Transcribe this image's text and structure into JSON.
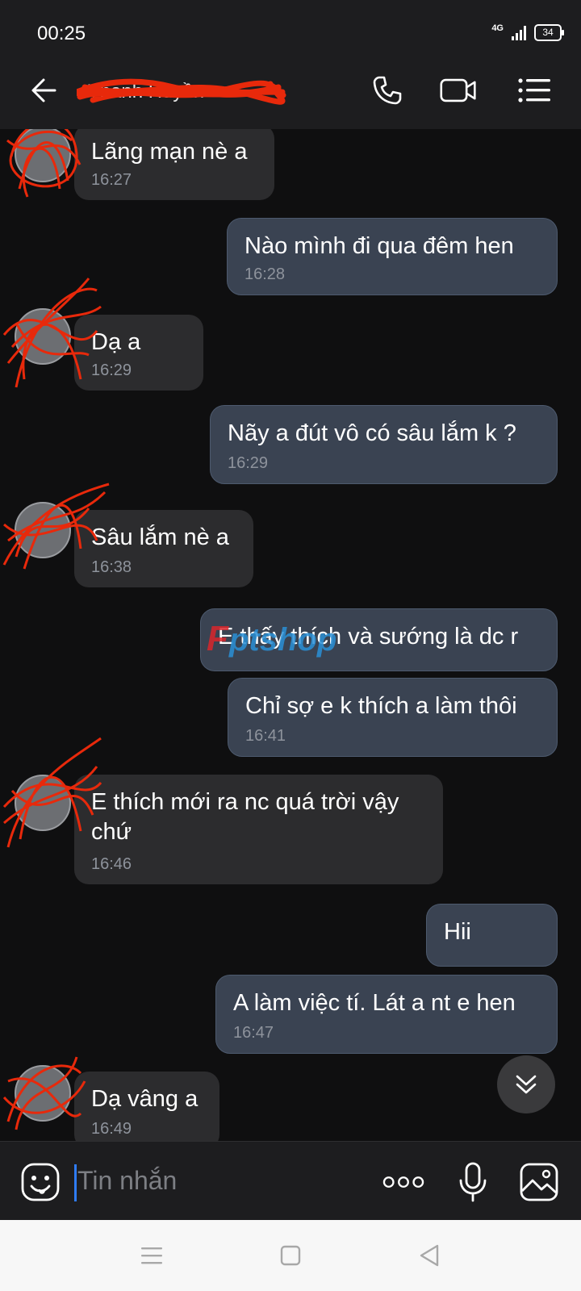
{
  "status": {
    "time": "00:25",
    "network": "4G",
    "battery": "34"
  },
  "header": {
    "contact_name": "Thanh Huyền"
  },
  "messages": [
    {
      "dir": "in",
      "text": "Lãng mạn nè a",
      "time": "16:27"
    },
    {
      "dir": "out",
      "text": "Nào mình đi qua đêm hen",
      "time": "16:28"
    },
    {
      "dir": "in",
      "text": "Dạ a",
      "time": "16:29"
    },
    {
      "dir": "out",
      "text": "Nãy a đút vô có sâu lắm k ?",
      "time": "16:29"
    },
    {
      "dir": "in",
      "text": "Sâu lắm nè a",
      "time": "16:38"
    },
    {
      "dir": "out",
      "text": "E thấy thích và sướng là dc r",
      "time": ""
    },
    {
      "dir": "out",
      "text": "Chỉ sợ e k thích a làm thôi",
      "time": "16:41"
    },
    {
      "dir": "in",
      "text": "E thích mới ra nc quá trời vậy\nchứ",
      "time": "16:46"
    },
    {
      "dir": "out",
      "text": "Hii",
      "time": ""
    },
    {
      "dir": "out",
      "text": "A làm việc tí. Lát a nt e hen",
      "time": "16:47"
    },
    {
      "dir": "in",
      "text": "Dạ vâng a",
      "time": "16:49"
    }
  ],
  "input": {
    "placeholder": "Tin nhắn"
  },
  "watermark": {
    "text": "Fptshop"
  },
  "colors": {
    "incoming_bubble": "#2c2c2e",
    "outgoing_bubble": "#3a4352",
    "accent": "#2f7cf6",
    "redaction": "#e8290b"
  }
}
